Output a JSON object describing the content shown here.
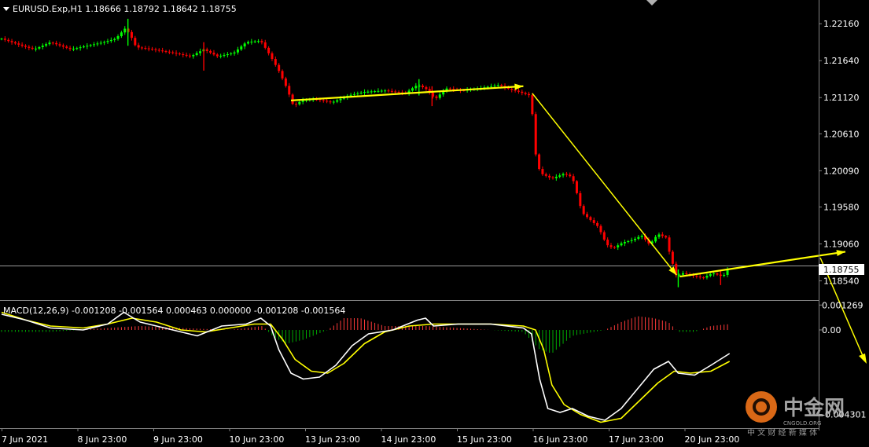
{
  "symbol_header": "EURUSD.Exp,H1  1.18666 1.18792 1.18642 1.18755",
  "macd_header": "MACD(12,26,9) -0.001208 -0.001564 0.000463 0.000000 -0.001208 -0.001564",
  "current_price_label": "1.18755",
  "watermark": {
    "brand": "中金网",
    "domain": "CNGOLD.ORG",
    "slogan": "中 文 财 经 新 媒 体"
  },
  "colors": {
    "bull": "#00ff00",
    "bear": "#ff0000",
    "macd_main": "#ffffff",
    "macd_signal": "#ffff00",
    "arrow": "#ffff00",
    "grid": "#808080"
  },
  "chart_data": [
    {
      "type": "candlestick",
      "title": "EURUSD.Exp,H1",
      "ohlc_last": {
        "open": 1.18666,
        "high": 1.18792,
        "low": 1.18642,
        "close": 1.18755
      },
      "ylim": [
        1.1828,
        1.2245
      ],
      "y_ticks": [
        "1.22160",
        "1.21640",
        "1.21120",
        "1.20610",
        "1.20090",
        "1.19580",
        "1.19060",
        "1.18540"
      ],
      "x_ticks": [
        "7 Jun 2021",
        "8 Jun 23:00",
        "9 Jun 23:00",
        "10 Jun 23:00",
        "13 Jun 23:00",
        "14 Jun 23:00",
        "15 Jun 23:00",
        "16 Jun 23:00",
        "17 Jun 23:00",
        "20 Jun 23:00"
      ],
      "x_range": [
        0,
        900
      ],
      "price_path": [
        [
          0,
          1.2195
        ],
        [
          25,
          1.2185
        ],
        [
          40,
          1.218
        ],
        [
          60,
          1.219
        ],
        [
          85,
          1.218
        ],
        [
          105,
          1.2185
        ],
        [
          125,
          1.219
        ],
        [
          140,
          1.2195
        ],
        [
          152,
          1.221
        ],
        [
          158,
          1.22
        ],
        [
          165,
          1.2183
        ],
        [
          185,
          1.218
        ],
        [
          210,
          1.2175
        ],
        [
          232,
          1.217
        ],
        [
          248,
          1.218
        ],
        [
          265,
          1.217
        ],
        [
          285,
          1.2175
        ],
        [
          300,
          1.219
        ],
        [
          318,
          1.2192
        ],
        [
          330,
          1.217
        ],
        [
          340,
          1.215
        ],
        [
          350,
          1.2125
        ],
        [
          358,
          1.21
        ],
        [
          368,
          1.2108
        ],
        [
          385,
          1.211
        ],
        [
          405,
          1.2105
        ],
        [
          425,
          1.2115
        ],
        [
          445,
          1.212
        ],
        [
          470,
          1.2122
        ],
        [
          495,
          1.2118
        ],
        [
          510,
          1.213
        ],
        [
          520,
          1.2125
        ],
        [
          532,
          1.211
        ],
        [
          545,
          1.2125
        ],
        [
          565,
          1.2122
        ],
        [
          585,
          1.2125
        ],
        [
          600,
          1.2128
        ],
        [
          610,
          1.213
        ],
        [
          620,
          1.2125
        ],
        [
          635,
          1.212
        ],
        [
          648,
          1.2115
        ],
        [
          652,
          1.208
        ],
        [
          656,
          1.202
        ],
        [
          662,
          1.2005
        ],
        [
          675,
          1.1998
        ],
        [
          690,
          1.2005
        ],
        [
          700,
          1.2
        ],
        [
          705,
          1.198
        ],
        [
          712,
          1.195
        ],
        [
          722,
          1.194
        ],
        [
          732,
          1.193
        ],
        [
          742,
          1.1905
        ],
        [
          750,
          1.19
        ],
        [
          762,
          1.1908
        ],
        [
          775,
          1.1912
        ],
        [
          785,
          1.1918
        ],
        [
          795,
          1.1905
        ],
        [
          805,
          1.192
        ],
        [
          815,
          1.1915
        ],
        [
          820,
          1.189
        ],
        [
          828,
          1.186
        ],
        [
          835,
          1.1865
        ],
        [
          845,
          1.1862
        ],
        [
          860,
          1.1858
        ],
        [
          872,
          1.1865
        ],
        [
          885,
          1.186
        ],
        [
          893,
          1.18755
        ]
      ],
      "spikes": [
        {
          "x": 155,
          "high": 1.2223,
          "low": 1.2185
        },
        {
          "x": 248,
          "high": 1.219,
          "low": 1.215
        },
        {
          "x": 512,
          "high": 1.2138,
          "low": 1.2115
        },
        {
          "x": 528,
          "high": 1.2128,
          "low": 1.21
        },
        {
          "x": 830,
          "high": 1.187,
          "low": 1.1845
        },
        {
          "x": 882,
          "high": 1.1868,
          "low": 1.1848
        }
      ],
      "current_price": 1.18755,
      "annotations": [
        {
          "kind": "arrow",
          "from": [
            355,
            1.2108
          ],
          "to": [
            640,
            1.2128
          ]
        },
        {
          "kind": "arrow",
          "from": [
            651,
            1.2118
          ],
          "to": [
            828,
            1.1862
          ]
        },
        {
          "kind": "arrow",
          "from": [
            832,
            1.186
          ],
          "to": [
            1035,
            1.1895
          ]
        }
      ]
    },
    {
      "type": "macd",
      "title": "MACD(12,26,9)",
      "params": [
        12,
        26,
        9
      ],
      "values_header": [
        -0.001208,
        -0.001564,
        0.000463,
        0.0,
        -0.001208,
        -0.001564
      ],
      "ylim": [
        -0.005,
        0.0014
      ],
      "y_ticks": [
        "0.001269",
        "0.00",
        "-0.004301"
      ],
      "main": [
        [
          0,
          0.0008
        ],
        [
          30,
          0.0005
        ],
        [
          60,
          0.0001
        ],
        [
          100,
          0.0
        ],
        [
          130,
          0.0003
        ],
        [
          150,
          0.0009
        ],
        [
          170,
          0.0004
        ],
        [
          210,
          0.0
        ],
        [
          240,
          -0.0003
        ],
        [
          270,
          0.0002
        ],
        [
          300,
          0.0003
        ],
        [
          318,
          0.0006
        ],
        [
          330,
          0.0002
        ],
        [
          340,
          -0.001
        ],
        [
          355,
          -0.0022
        ],
        [
          370,
          -0.0025
        ],
        [
          390,
          -0.0024
        ],
        [
          410,
          -0.0018
        ],
        [
          430,
          -0.0008
        ],
        [
          450,
          -0.0002
        ],
        [
          480,
          0.0
        ],
        [
          510,
          0.0005
        ],
        [
          520,
          0.0006
        ],
        [
          530,
          0.0002
        ],
        [
          560,
          0.0003
        ],
        [
          600,
          0.0003
        ],
        [
          640,
          0.0001
        ],
        [
          650,
          -0.0002
        ],
        [
          660,
          -0.0025
        ],
        [
          670,
          -0.004
        ],
        [
          685,
          -0.0042
        ],
        [
          700,
          -0.004
        ],
        [
          720,
          -0.0044
        ],
        [
          740,
          -0.0046
        ],
        [
          760,
          -0.004
        ],
        [
          780,
          -0.003
        ],
        [
          800,
          -0.002
        ],
        [
          818,
          -0.0016
        ],
        [
          830,
          -0.0022
        ],
        [
          850,
          -0.0023
        ],
        [
          870,
          -0.0018
        ],
        [
          893,
          -0.0012
        ]
      ],
      "signal": [
        [
          0,
          0.0009
        ],
        [
          30,
          0.0005
        ],
        [
          60,
          0.0002
        ],
        [
          100,
          0.0001
        ],
        [
          130,
          0.0003
        ],
        [
          160,
          0.0006
        ],
        [
          190,
          0.0004
        ],
        [
          220,
          0.0
        ],
        [
          250,
          -0.0001
        ],
        [
          280,
          0.0001
        ],
        [
          310,
          0.0003
        ],
        [
          330,
          0.0003
        ],
        [
          345,
          -0.0005
        ],
        [
          360,
          -0.0015
        ],
        [
          380,
          -0.0021
        ],
        [
          400,
          -0.0022
        ],
        [
          420,
          -0.0017
        ],
        [
          445,
          -0.0007
        ],
        [
          470,
          -0.0001
        ],
        [
          500,
          0.0002
        ],
        [
          530,
          0.0003
        ],
        [
          560,
          0.0003
        ],
        [
          600,
          0.0003
        ],
        [
          640,
          0.0002
        ],
        [
          655,
          0.0
        ],
        [
          665,
          -0.001
        ],
        [
          675,
          -0.0028
        ],
        [
          690,
          -0.0038
        ],
        [
          710,
          -0.0043
        ],
        [
          735,
          -0.0047
        ],
        [
          760,
          -0.0045
        ],
        [
          785,
          -0.0035
        ],
        [
          805,
          -0.0027
        ],
        [
          825,
          -0.0021
        ],
        [
          845,
          -0.0022
        ],
        [
          870,
          -0.0021
        ],
        [
          893,
          -0.0016
        ]
      ],
      "histogram": [
        [
          0,
          -0.0001
        ],
        [
          60,
          -0.0001
        ],
        [
          130,
          0.0001
        ],
        [
          170,
          0.0002
        ],
        [
          220,
          0.0001
        ],
        [
          280,
          0.0
        ],
        [
          320,
          0.0002
        ],
        [
          335,
          -0.0004
        ],
        [
          350,
          -0.0007
        ],
        [
          370,
          -0.0005
        ],
        [
          400,
          0.0
        ],
        [
          420,
          0.0006
        ],
        [
          440,
          0.0006
        ],
        [
          470,
          0.0002
        ],
        [
          520,
          0.0002
        ],
        [
          560,
          0.0001
        ],
        [
          600,
          0.0
        ],
        [
          640,
          -0.0001
        ],
        [
          660,
          -0.001
        ],
        [
          675,
          -0.0012
        ],
        [
          700,
          -0.0003
        ],
        [
          740,
          0.0
        ],
        [
          760,
          0.0004
        ],
        [
          780,
          0.0007
        ],
        [
          800,
          0.0006
        ],
        [
          818,
          0.0004
        ],
        [
          830,
          -0.0001
        ],
        [
          850,
          -0.0001
        ],
        [
          870,
          0.0002
        ],
        [
          893,
          0.0003
        ]
      ]
    }
  ]
}
